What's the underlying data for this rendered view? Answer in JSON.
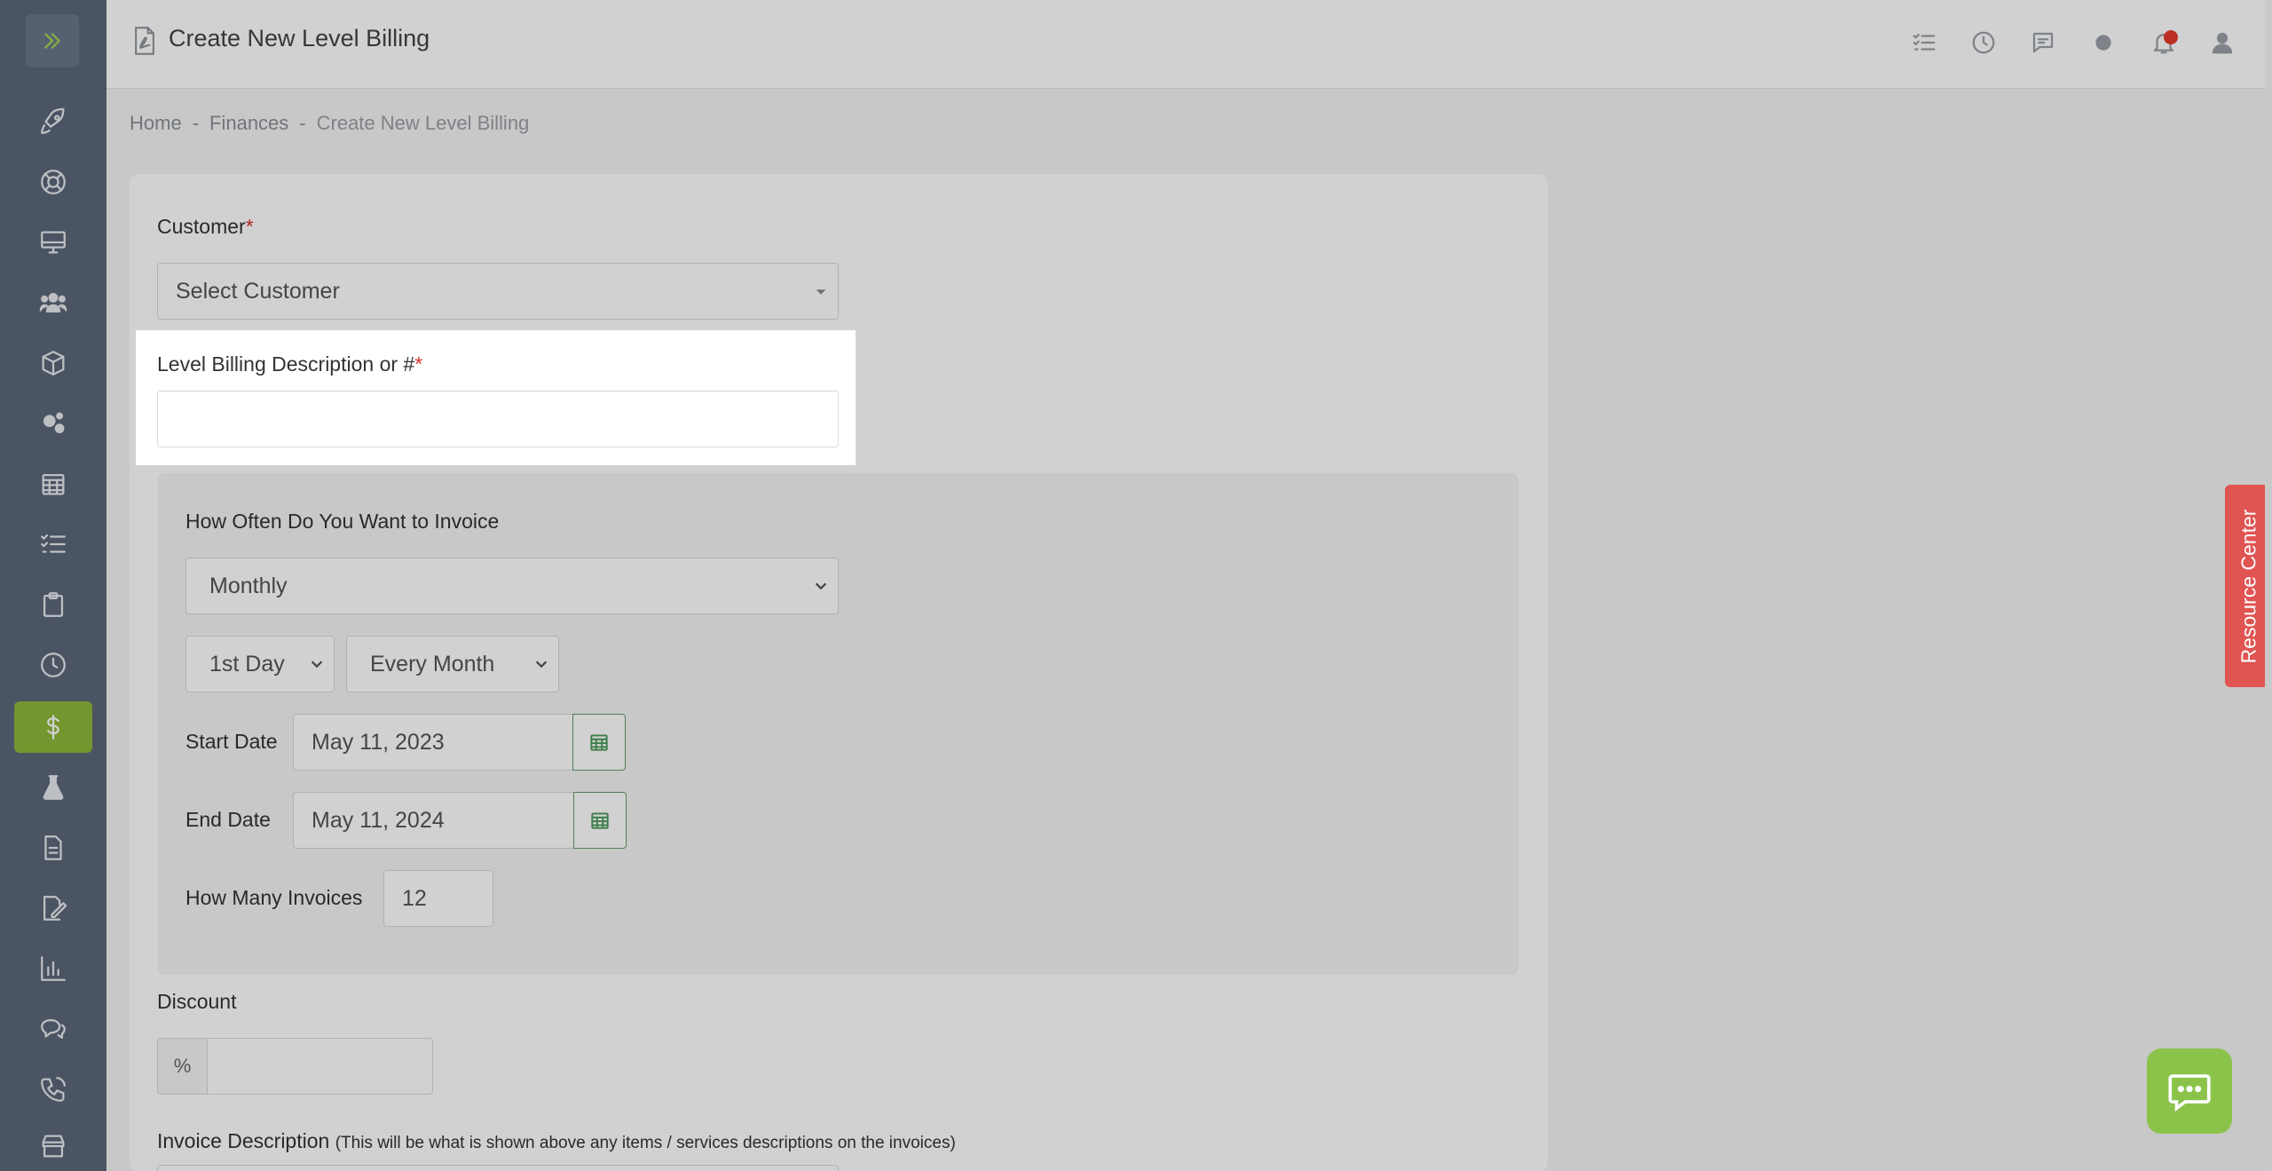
{
  "topbar": {
    "title": "Create New Level Billing"
  },
  "breadcrumb": {
    "items": [
      "Home",
      "Finances",
      "Create New Level Billing"
    ],
    "separator": "-"
  },
  "form": {
    "customer_label": "Customer",
    "customer_placeholder": "Select Customer",
    "description_label": "Level Billing Description or #",
    "description_value": "",
    "required_mark": "*",
    "frequency_label": "How Often Do You Want to Invoice",
    "frequency_value": "Monthly",
    "day_value": "1st Day",
    "interval_value": "Every Month",
    "start_date_label": "Start Date",
    "start_date_value": "May 11, 2023",
    "end_date_label": "End Date",
    "end_date_value": "May 11, 2024",
    "invoices_label": "How Many Invoices",
    "invoices_value": "12",
    "discount_label": "Discount",
    "discount_symbol": "%",
    "discount_value": "",
    "invoice_desc_label": "Invoice Description",
    "invoice_desc_note": "(This will be what is shown above any items / services descriptions on the invoices)"
  },
  "resource_center": {
    "label": "Resource Center"
  },
  "colors": {
    "sidebar": "#5b6779",
    "active": "#8db83a",
    "required": "#d9302c",
    "resource_tab": "#e05452"
  }
}
